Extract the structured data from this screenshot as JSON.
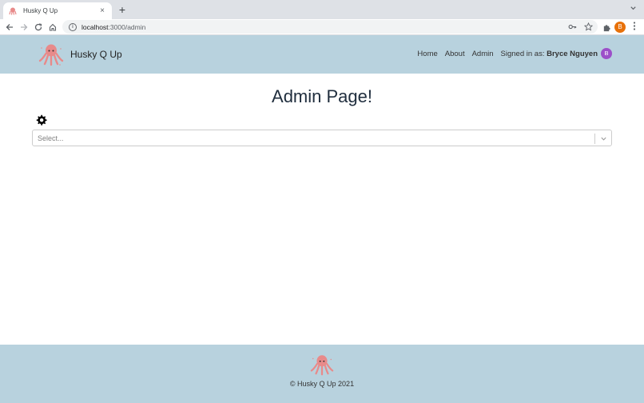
{
  "browser": {
    "tab_title": "Husky Q Up",
    "tab_close": "×",
    "new_tab": "+",
    "url_host": "localhost",
    "url_path": ":3000/admin",
    "profile_initial": "B"
  },
  "header": {
    "brand_name": "Husky Q Up",
    "nav": [
      "Home",
      "About",
      "Admin"
    ],
    "signed_in_prefix": "Signed in as: ",
    "user_name": "Bryce Nguyen",
    "user_initial": "B"
  },
  "main": {
    "title": "Admin Page!",
    "select_placeholder": "Select..."
  },
  "footer": {
    "text": "© Husky Q Up 2021"
  },
  "colors": {
    "header_bg": "#b8d2de",
    "user_avatar": "#9c4fc9",
    "profile_avatar": "#e8710a",
    "octopus": "#e88a8a"
  }
}
